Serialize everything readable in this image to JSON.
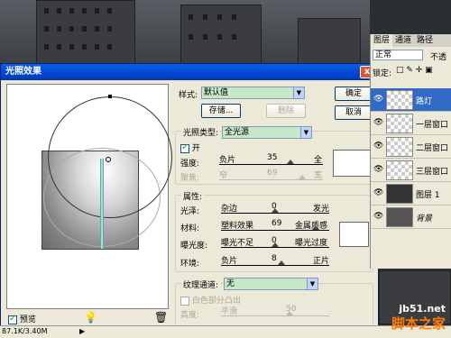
{
  "dialog": {
    "title": "光照效果",
    "close_label": "x",
    "style_label": "样式:",
    "style_value": "默认值",
    "save_label": "存储...",
    "delete_label": "删除",
    "ok_label": "确定",
    "cancel_label": "取消",
    "light_type_label": "光照类型:",
    "light_type_value": "全光源",
    "on_label": "开",
    "intensity": {
      "label": "强度:",
      "left": "负片",
      "value": "35",
      "right": "全"
    },
    "focus": {
      "label": "聚焦:",
      "left": "窄",
      "value": "69",
      "right": "宽"
    },
    "properties_label": "属性:",
    "gloss": {
      "label": "光泽:",
      "left": "杂边",
      "value": "0",
      "right": "发光"
    },
    "material": {
      "label": "材料:",
      "left": "塑料效果",
      "value": "69",
      "right": "金属质感"
    },
    "exposure": {
      "label": "曝光度:",
      "left": "曝光不足",
      "value": "0",
      "right": "曝光过度"
    },
    "ambience": {
      "label": "环境:",
      "left": "负片",
      "value": "8",
      "right": "正片"
    },
    "texture_label": "纹理通道:",
    "texture_value": "无",
    "white_high_label": "白色部分凸出",
    "height": {
      "label": "高度:",
      "left": "平滑",
      "value": "50",
      "right": "凸起"
    },
    "preview_label": "预览"
  },
  "layers_panel": {
    "tabs": [
      "图层",
      "通道",
      "路径"
    ],
    "blend_mode": "正常",
    "opacity_label": "不透",
    "lock_label": "锁定:",
    "layers": [
      {
        "name": "路灯",
        "selected": true
      },
      {
        "name": "一层窗口",
        "selected": false
      },
      {
        "name": "二层窗口",
        "selected": false
      },
      {
        "name": "三层窗口",
        "selected": false
      },
      {
        "name": "图层 1",
        "selected": false
      },
      {
        "name": "背景",
        "selected": false
      }
    ]
  },
  "status_bar": {
    "doc_size": "87.1K/3.40M"
  },
  "watermark": {
    "line1": "jb51.net",
    "line2": "脚本之家"
  }
}
